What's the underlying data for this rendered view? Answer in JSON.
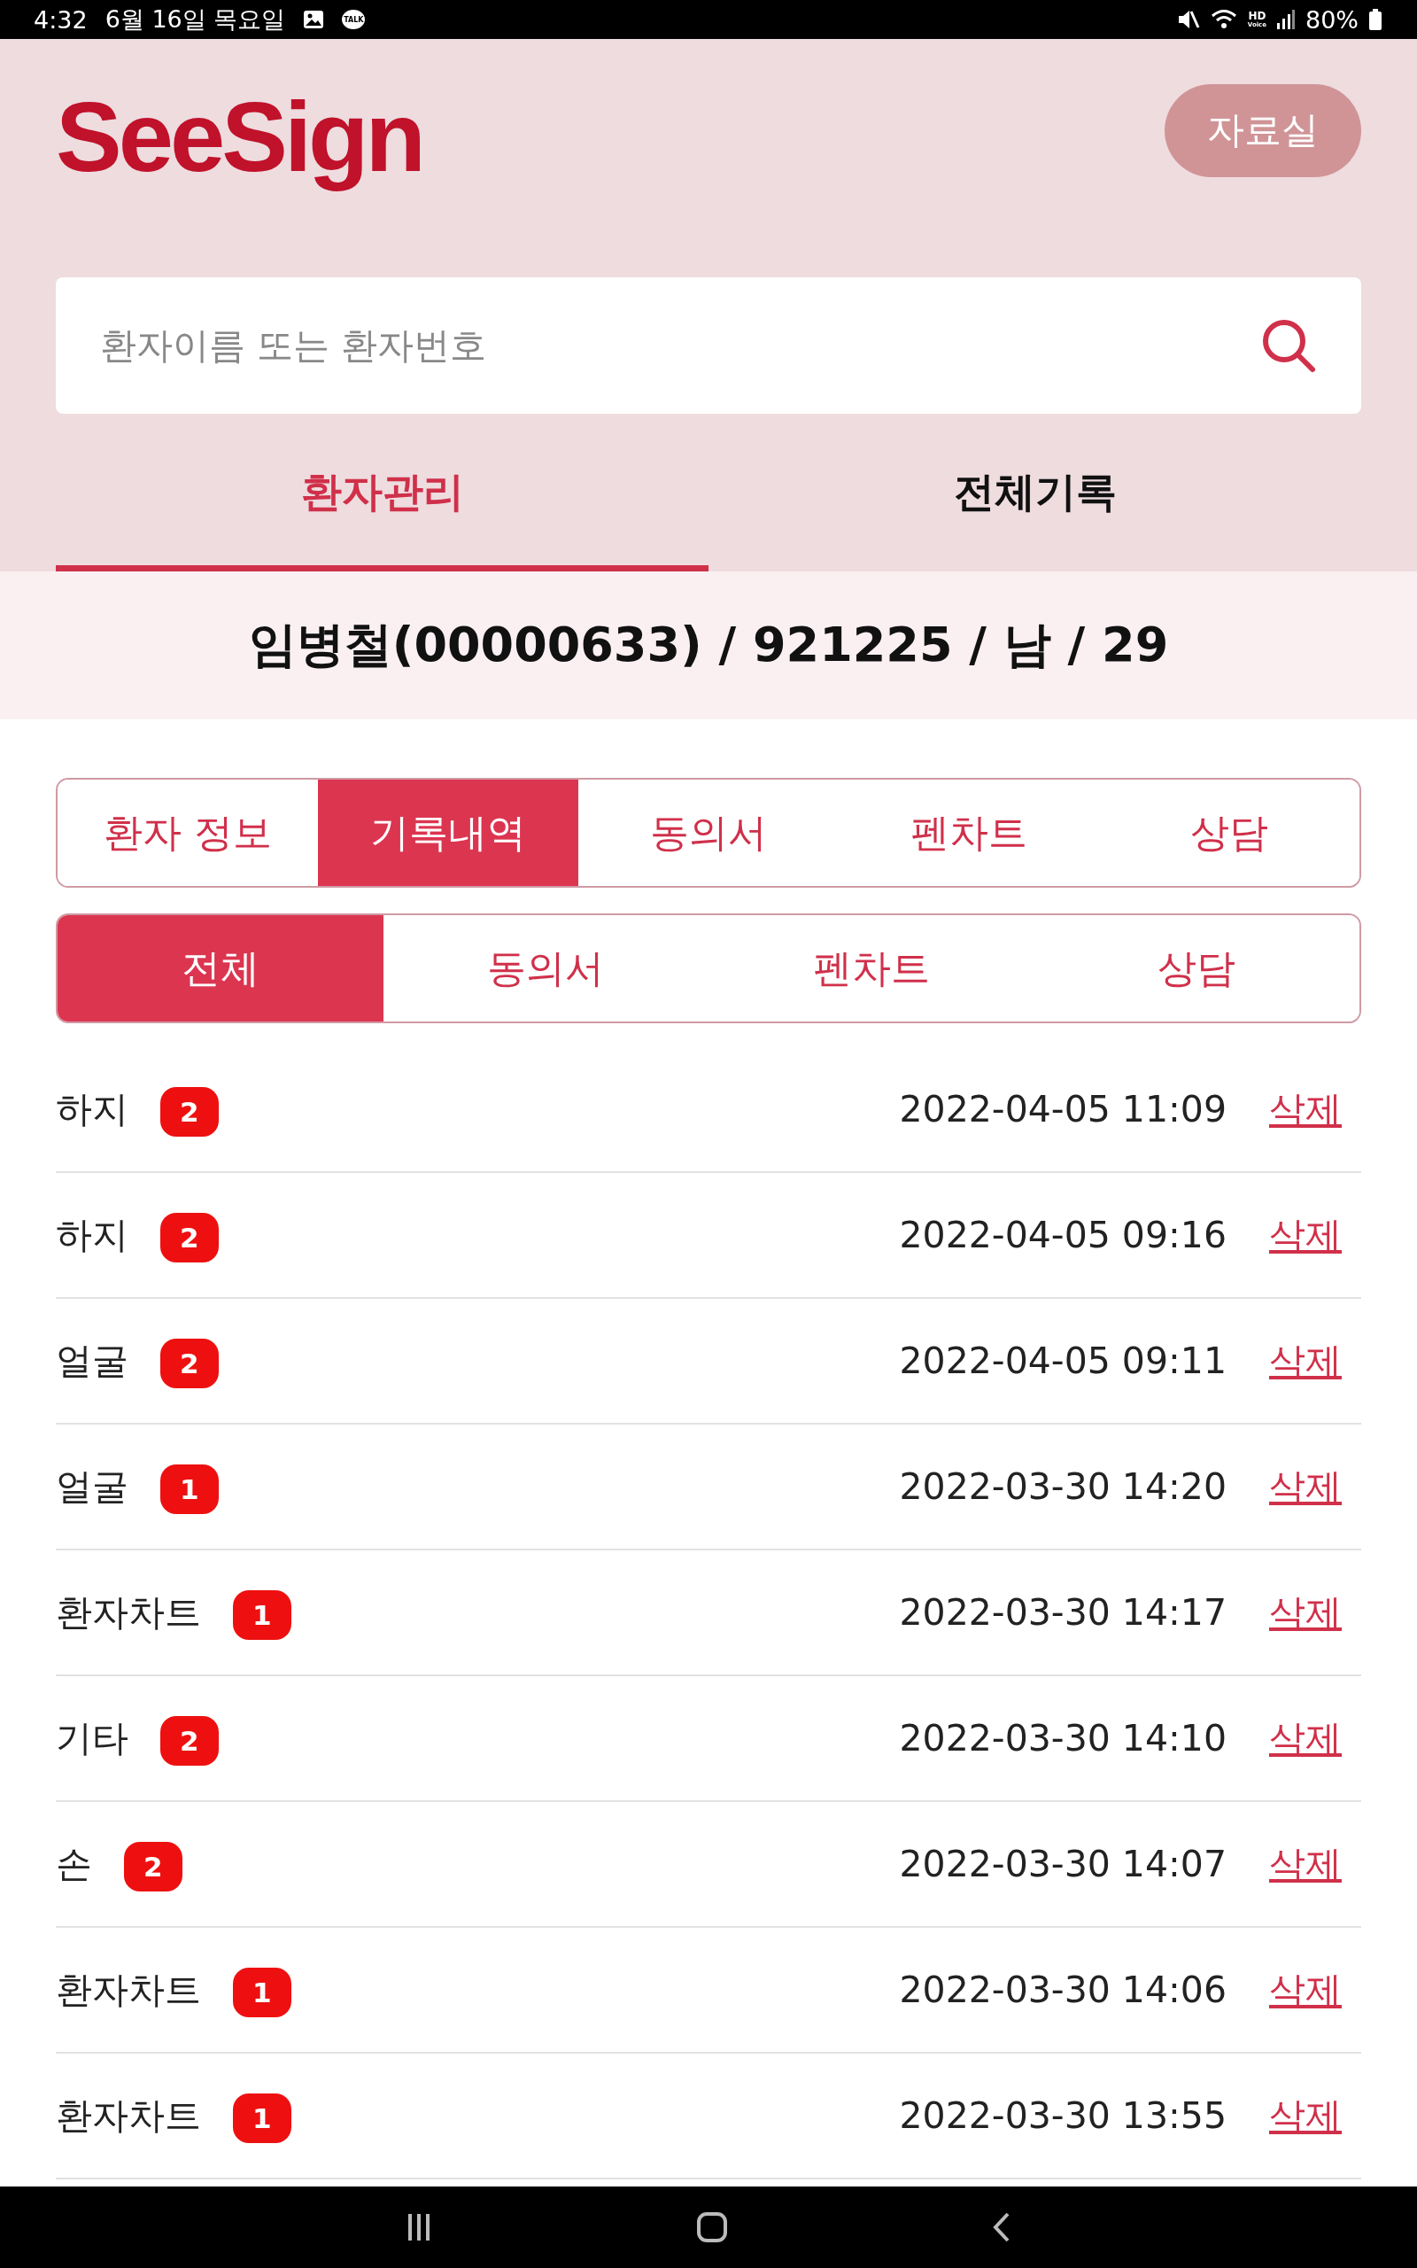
{
  "status_bar": {
    "time": "4:32",
    "date": "6월 16일 목요일",
    "chat_label": "TALK",
    "hd_label": "HD",
    "voice_label": "Voice",
    "battery": "80%"
  },
  "header": {
    "logo": "SeeSign",
    "library_button": "자료실"
  },
  "search": {
    "placeholder": "환자이름 또는 환자번호"
  },
  "main_tabs": [
    {
      "label": "환자관리",
      "selected": true
    },
    {
      "label": "전체기록",
      "selected": false
    }
  ],
  "patient_summary": "임병철(00000633) / 921225 / 남 / 29",
  "section_tabs": [
    {
      "label": "환자 정보",
      "selected": false
    },
    {
      "label": "기록내역",
      "selected": true
    },
    {
      "label": "동의서",
      "selected": false
    },
    {
      "label": "펜차트",
      "selected": false
    },
    {
      "label": "상담",
      "selected": false
    }
  ],
  "filter_tabs": [
    {
      "label": "전체",
      "selected": true
    },
    {
      "label": "동의서",
      "selected": false
    },
    {
      "label": "펜차트",
      "selected": false
    },
    {
      "label": "상담",
      "selected": false
    }
  ],
  "records": [
    {
      "title": "하지",
      "count": "2",
      "datetime": "2022-04-05 11:09",
      "action": "삭제"
    },
    {
      "title": "하지",
      "count": "2",
      "datetime": "2022-04-05 09:16",
      "action": "삭제"
    },
    {
      "title": "얼굴",
      "count": "2",
      "datetime": "2022-04-05 09:11",
      "action": "삭제"
    },
    {
      "title": "얼굴",
      "count": "1",
      "datetime": "2022-03-30 14:20",
      "action": "삭제"
    },
    {
      "title": "환자차트",
      "count": "1",
      "datetime": "2022-03-30 14:17",
      "action": "삭제"
    },
    {
      "title": "기타",
      "count": "2",
      "datetime": "2022-03-30 14:10",
      "action": "삭제"
    },
    {
      "title": "손",
      "count": "2",
      "datetime": "2022-03-30 14:07",
      "action": "삭제"
    },
    {
      "title": "환자차트",
      "count": "1",
      "datetime": "2022-03-30 14:06",
      "action": "삭제"
    },
    {
      "title": "환자차트",
      "count": "1",
      "datetime": "2022-03-30 13:55",
      "action": "삭제"
    }
  ]
}
